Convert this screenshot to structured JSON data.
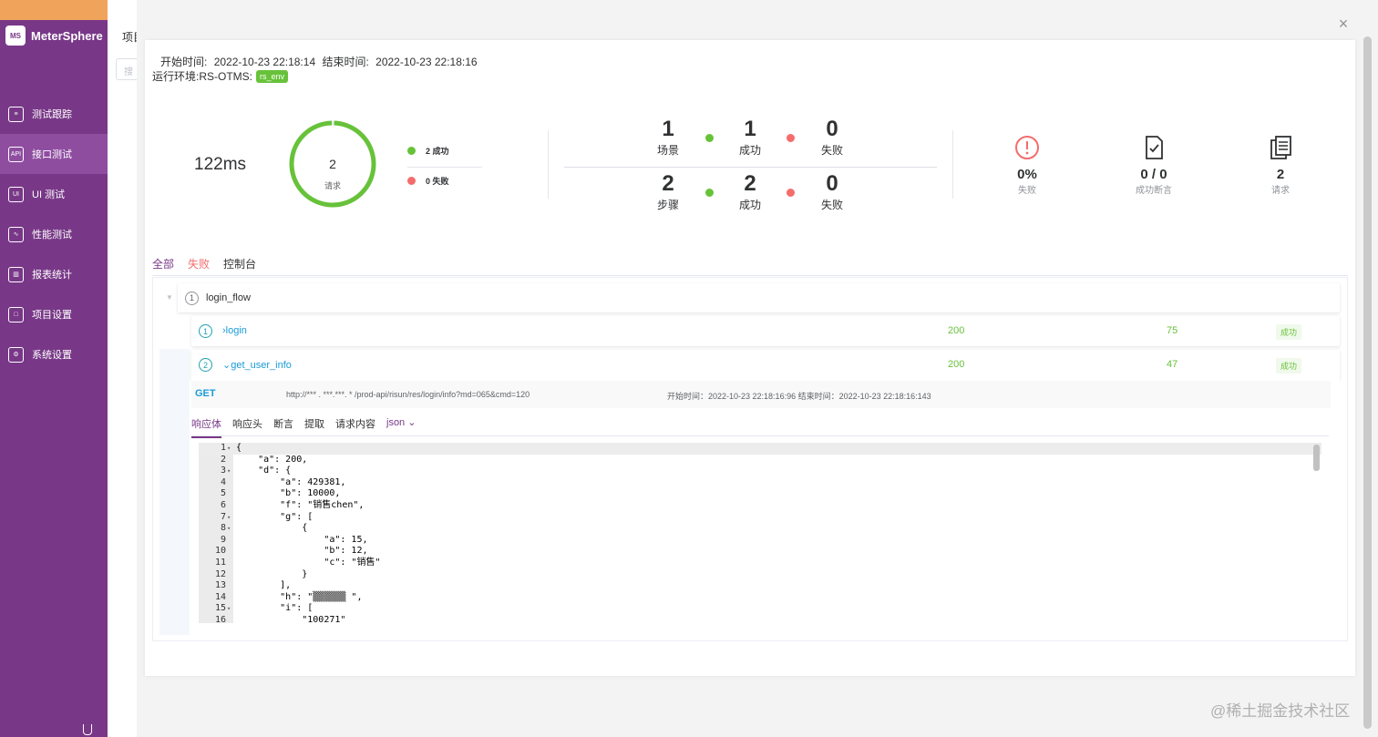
{
  "app": {
    "name": "MeterSphere",
    "logo_text": "MS"
  },
  "sidebar": {
    "items": [
      {
        "label": "测试跟踪",
        "icon": "clipboard-icon",
        "glyph": "≡",
        "active": false
      },
      {
        "label": "接口测试",
        "icon": "api-icon",
        "glyph": "API",
        "active": true
      },
      {
        "label": "UI 测试",
        "icon": "ui-icon",
        "glyph": "UI",
        "active": false
      },
      {
        "label": "性能测试",
        "icon": "performance-icon",
        "glyph": "∿",
        "active": false
      },
      {
        "label": "报表统计",
        "icon": "report-icon",
        "glyph": "▥",
        "active": false
      },
      {
        "label": "项目设置",
        "icon": "folder-icon",
        "glyph": "□",
        "active": false
      },
      {
        "label": "系统设置",
        "icon": "gear-icon",
        "glyph": "⚙",
        "active": false
      }
    ]
  },
  "background": {
    "tab": "项目",
    "search_placeholder": "搜"
  },
  "report": {
    "start_label": "开始时间:",
    "start_time": "2022-10-23 22:18:14",
    "end_label": "结束时间:",
    "end_time": "2022-10-23 22:18:16",
    "env_label": "运行环境:RS-OTMS:",
    "env_badge": "rs_env",
    "duration": "122ms",
    "ring": {
      "count": "2",
      "label": "请求",
      "success_fraction": 1.0
    },
    "legend": [
      {
        "label": "2 成功",
        "color": "#67c23a"
      },
      {
        "label": "0 失败",
        "color": "#f56c6c"
      }
    ],
    "scene_stats": {
      "total": "1",
      "total_label": "场景",
      "success": "1",
      "success_label": "成功",
      "fail": "0",
      "fail_label": "失败"
    },
    "step_stats": {
      "total": "2",
      "total_label": "步骤",
      "success": "2",
      "success_label": "成功",
      "fail": "0",
      "fail_label": "失败"
    },
    "kpis": [
      {
        "value": "0%",
        "label": "失败",
        "icon": "error-circle-icon"
      },
      {
        "value": "0 / 0",
        "label": "成功断言",
        "icon": "document-check-icon"
      },
      {
        "value": "2",
        "label": "请求",
        "icon": "documents-icon"
      }
    ],
    "tabs": [
      "全部",
      "失败",
      "控制台"
    ],
    "scenario": {
      "index": "1",
      "name": "login_flow"
    },
    "steps": [
      {
        "index": "1",
        "name": "login",
        "caret": "›",
        "code": "200",
        "time": "75",
        "status": "成功"
      },
      {
        "index": "2",
        "name": "get_user_info",
        "caret": "⌄",
        "code": "200",
        "time": "47",
        "status": "成功"
      }
    ],
    "request": {
      "method": "GET",
      "url": "http://*** . ***.***. * /prod-api/risun/res/login/info?md=065&cmd=120",
      "time": "开始时间：2022-10-23 22:18:16:96 结束时间：2022-10-23 22:18:16:143"
    },
    "response_tabs": [
      "响应体",
      "响应头",
      "断言",
      "提取",
      "请求内容"
    ],
    "response_format": "json",
    "code_lines": [
      {
        "n": "1",
        "fold": true,
        "text": "{"
      },
      {
        "n": "2",
        "fold": false,
        "text": "    \"a\": 200,"
      },
      {
        "n": "3",
        "fold": true,
        "text": "    \"d\": {"
      },
      {
        "n": "4",
        "fold": false,
        "text": "        \"a\": 429381,"
      },
      {
        "n": "5",
        "fold": false,
        "text": "        \"b\": 10000,"
      },
      {
        "n": "6",
        "fold": false,
        "text": "        \"f\": \"销售chen\","
      },
      {
        "n": "7",
        "fold": true,
        "text": "        \"g\": ["
      },
      {
        "n": "8",
        "fold": true,
        "text": "            {"
      },
      {
        "n": "9",
        "fold": false,
        "text": "                \"a\": 15,"
      },
      {
        "n": "10",
        "fold": false,
        "text": "                \"b\": 12,"
      },
      {
        "n": "11",
        "fold": false,
        "text": "                \"c\": \"销售\""
      },
      {
        "n": "12",
        "fold": false,
        "text": "            }"
      },
      {
        "n": "13",
        "fold": false,
        "text": "        ],"
      },
      {
        "n": "14",
        "fold": false,
        "text": "        \"h\": \"▒▒▒▒▒▒ \","
      },
      {
        "n": "15",
        "fold": true,
        "text": "        \"i\": ["
      },
      {
        "n": "16",
        "fold": false,
        "text": "            \"100271\""
      }
    ]
  },
  "watermark": "@稀土掘金技术社区",
  "colors": {
    "brand": "#783887",
    "success": "#67c23a",
    "fail": "#f56c6c",
    "link": "#1a9bd7"
  }
}
